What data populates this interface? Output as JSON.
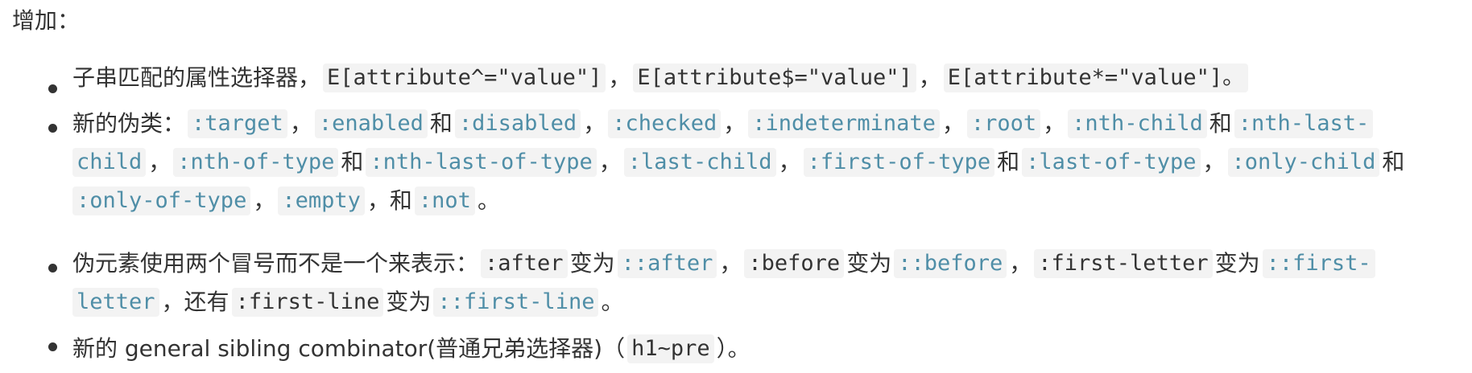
{
  "intro": "增加：",
  "items": [
    {
      "lines": [
        [
          {
            "t": "子串匹配的属性选择器，"
          },
          {
            "t": "E[attribute^=\"value\"]",
            "c": "black"
          },
          {
            "t": "，"
          },
          {
            "t": "E[attribute$=\"value\"]",
            "c": "black"
          },
          {
            "t": "，"
          },
          {
            "t": "E[attribute*=\"value\"]。",
            "c": "black"
          }
        ]
      ]
    },
    {
      "lines": [
        [
          {
            "t": "新的伪类："
          },
          {
            "t": ":target",
            "c": "blue"
          },
          {
            "t": "，"
          },
          {
            "t": ":enabled",
            "c": "blue"
          },
          {
            "t": "和"
          },
          {
            "t": ":disabled",
            "c": "blue"
          },
          {
            "t": "，"
          },
          {
            "t": ":checked",
            "c": "blue"
          },
          {
            "t": "，"
          },
          {
            "t": ":indeterminate",
            "c": "blue"
          },
          {
            "t": "，"
          },
          {
            "t": ":root",
            "c": "blue"
          },
          {
            "t": "，"
          },
          {
            "t": ":nth-child",
            "c": "blue"
          },
          {
            "t": "和"
          },
          {
            "t": ":nth-last-",
            "c": "blue"
          }
        ],
        [
          {
            "t": "child",
            "c": "blue"
          },
          {
            "t": "，"
          },
          {
            "t": ":nth-of-type",
            "c": "blue"
          },
          {
            "t": "和"
          },
          {
            "t": ":nth-last-of-type",
            "c": "blue"
          },
          {
            "t": "，"
          },
          {
            "t": ":last-child",
            "c": "blue"
          },
          {
            "t": "，"
          },
          {
            "t": ":first-of-type",
            "c": "blue"
          },
          {
            "t": "和"
          },
          {
            "t": ":last-of-type",
            "c": "blue"
          },
          {
            "t": "，"
          },
          {
            "t": ":only-child",
            "c": "blue"
          },
          {
            "t": "和"
          }
        ],
        [
          {
            "t": ":only-of-type",
            "c": "blue"
          },
          {
            "t": "，"
          },
          {
            "t": ":empty",
            "c": "blue"
          },
          {
            "t": "，和"
          },
          {
            "t": ":not",
            "c": "blue"
          },
          {
            "t": "。"
          }
        ]
      ]
    },
    {
      "lines": [
        [
          {
            "t": "伪元素使用两个冒号而不是一个来表示："
          },
          {
            "t": ":after",
            "c": "black"
          },
          {
            "t": "变为"
          },
          {
            "t": "::after",
            "c": "blue"
          },
          {
            "t": "，"
          },
          {
            "t": ":before",
            "c": "black"
          },
          {
            "t": "变为"
          },
          {
            "t": "::before",
            "c": "blue"
          },
          {
            "t": "，"
          },
          {
            "t": ":first-letter",
            "c": "black"
          },
          {
            "t": "变为"
          },
          {
            "t": "::first-",
            "c": "blue"
          }
        ],
        [
          {
            "t": "letter",
            "c": "blue"
          },
          {
            "t": "，还有"
          },
          {
            "t": ":first-line",
            "c": "black"
          },
          {
            "t": "变为"
          },
          {
            "t": "::first-line",
            "c": "blue"
          },
          {
            "t": "。"
          }
        ]
      ]
    },
    {
      "lines": [
        [
          {
            "t": "新的 general sibling combinator(普通兄弟选择器)（"
          },
          {
            "t": "h1~pre",
            "c": "black"
          },
          {
            "t": "）。"
          }
        ]
      ]
    }
  ]
}
